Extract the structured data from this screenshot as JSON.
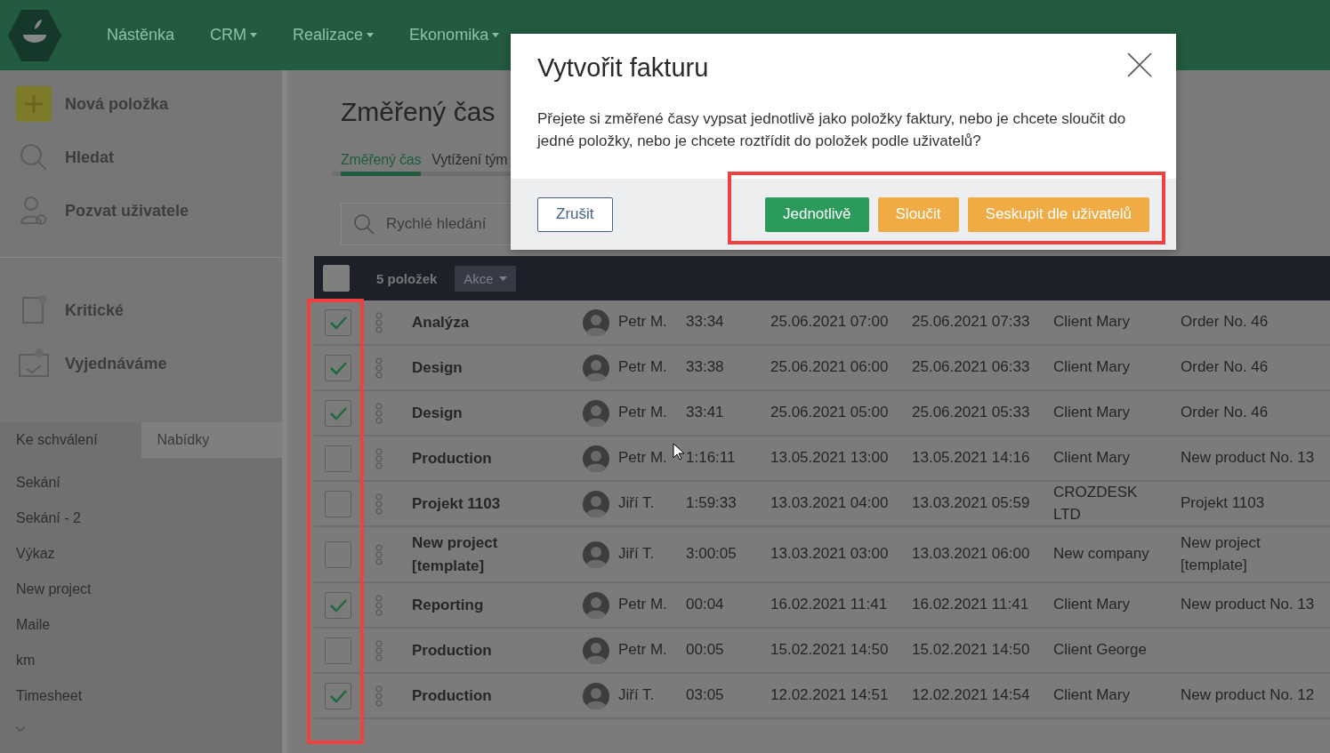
{
  "topbar": {
    "nav": [
      {
        "label": "Nástěnka",
        "has_menu": false
      },
      {
        "label": "CRM",
        "has_menu": true
      },
      {
        "label": "Realizace",
        "has_menu": true
      },
      {
        "label": "Ekonomika",
        "has_menu": true
      }
    ]
  },
  "sidebar": {
    "actions": [
      {
        "kind": "add",
        "label": "Nová položka"
      },
      {
        "kind": "search",
        "label": "Hledat"
      },
      {
        "kind": "invite",
        "label": "Pozvat uživatele"
      }
    ],
    "filters": [
      {
        "kind": "critical",
        "label": "Kritické"
      },
      {
        "kind": "negotiating",
        "label": "Vyjednáváme"
      }
    ],
    "tabs": [
      {
        "label": "Ke schválení",
        "selected": true
      },
      {
        "label": "Nabídky",
        "selected": false
      }
    ],
    "items": [
      "Sekání",
      "Sekání - 2",
      "Výkaz",
      "New project",
      "Maile",
      "km",
      "Timesheet"
    ]
  },
  "page": {
    "title": "Změřený čas",
    "tabs": [
      {
        "label": "Změřený čas",
        "selected": true
      },
      {
        "label": "Vytížení tým",
        "selected": false
      }
    ],
    "search": {
      "placeholder": "Rychlé hledání"
    }
  },
  "table": {
    "checkbox_column_highlighted": true,
    "header": {
      "all_checked": false,
      "count": "5 položek",
      "actions": "Akce"
    },
    "rows": [
      {
        "checked": true,
        "name": "Analýza",
        "user": "Petr M.",
        "duration": "33:34",
        "start": "25.06.2021 07:00",
        "end": "25.06.2021 07:33",
        "client": "Client Mary",
        "order": "Order No. 46"
      },
      {
        "checked": true,
        "name": "Design",
        "user": "Petr M.",
        "duration": "33:38",
        "start": "25.06.2021 06:00",
        "end": "25.06.2021 06:33",
        "client": "Client Mary",
        "order": "Order No. 46"
      },
      {
        "checked": true,
        "name": "Design",
        "user": "Petr M.",
        "duration": "33:41",
        "start": "25.06.2021 05:00",
        "end": "25.06.2021 05:33",
        "client": "Client Mary",
        "order": "Order No. 46"
      },
      {
        "checked": false,
        "name": "Production",
        "user": "Petr M.",
        "duration": "1:16:11",
        "start": "13.05.2021 13:00",
        "end": "13.05.2021 14:16",
        "client": "Client Mary",
        "order": "New product No. 13"
      },
      {
        "checked": false,
        "name": "Projekt 1103",
        "user": "Jiří T.",
        "duration": "1:59:33",
        "start": "13.03.2021 04:00",
        "end": "13.03.2021 05:59",
        "client": "CROZDESK LTD",
        "order": "Projekt 1103"
      },
      {
        "checked": false,
        "name": "New project [template]",
        "user": "Jiří T.",
        "duration": "3:00:05",
        "start": "13.03.2021 03:00",
        "end": "13.03.2021 06:00",
        "client": "New company",
        "order": "New project [template]"
      },
      {
        "checked": true,
        "name": "Reporting",
        "user": "Petr M.",
        "duration": "00:04",
        "start": "16.02.2021 11:41",
        "end": "16.02.2021 11:41",
        "client": "Client Mary",
        "order": "New product No. 13"
      },
      {
        "checked": false,
        "name": "Production",
        "user": "Petr M.",
        "duration": "00:05",
        "start": "15.02.2021 14:50",
        "end": "15.02.2021 14:50",
        "client": "Client George"
      },
      {
        "checked": true,
        "name": "Production",
        "user": "Jiří T.",
        "duration": "03:05",
        "start": "12.02.2021 14:51",
        "end": "12.02.2021 14:54",
        "client": "Client Mary",
        "order": "New product No. 12"
      }
    ]
  },
  "dialog": {
    "buttons_highlighted": true,
    "title": "Vytvořit fakturu",
    "message": "Přejete si změřené časy vypsat jednotlivě jako položky faktury, nebo je chcete sloučit do jedné položky, nebo je chcete roztřídit do položek podle uživatelů?",
    "buttons": [
      {
        "kind": "cancel",
        "label": "Zrušit"
      },
      {
        "kind": "primary",
        "label": "Jednotlivě"
      },
      {
        "kind": "warning",
        "label": "Sloučit"
      },
      {
        "kind": "warning",
        "label": "Seskupit dle uživatelů"
      }
    ]
  }
}
